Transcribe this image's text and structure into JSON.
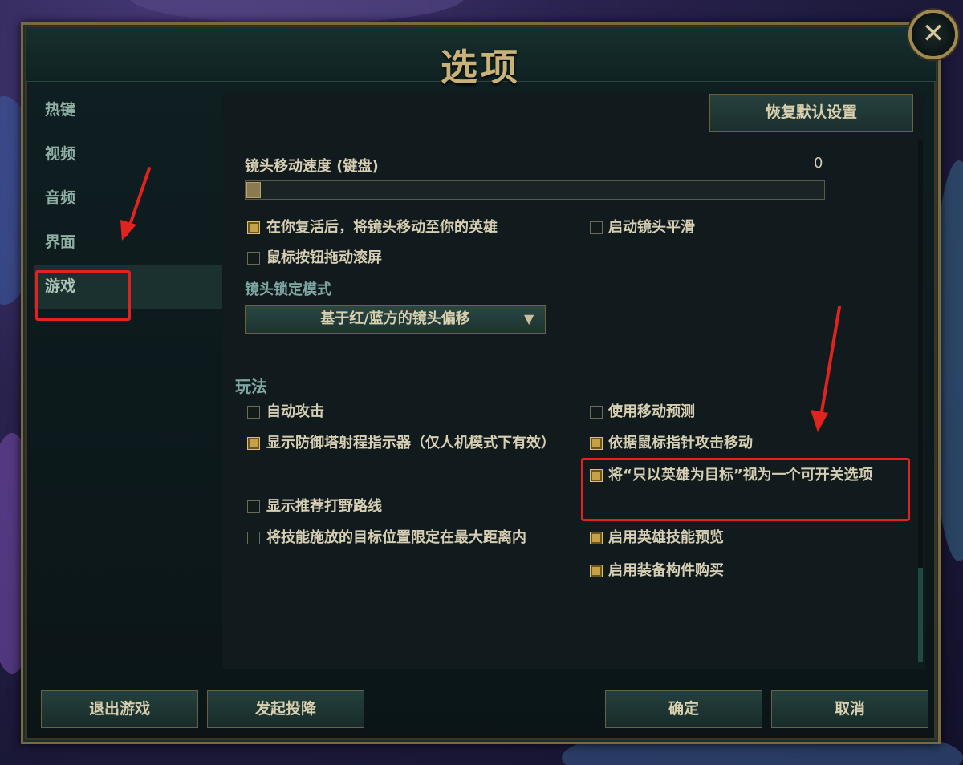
{
  "window": {
    "title": "选项",
    "close_glyph": "✕"
  },
  "sidebar": {
    "items": [
      {
        "label": "热键"
      },
      {
        "label": "视频"
      },
      {
        "label": "音频"
      },
      {
        "label": "界面"
      },
      {
        "label": "游戏",
        "active": true
      }
    ]
  },
  "toolbar": {
    "restore_defaults_label": "恢复默认设置"
  },
  "camera": {
    "speed_label": "镜头移动速度 (键盘)",
    "speed_value": "0",
    "speed_fraction": 0,
    "options": [
      {
        "label": "在你复活后，将镜头移动至你的英雄",
        "checked": true
      },
      {
        "label": "启动镜头平滑",
        "checked": false
      },
      {
        "label": "鼠标按钮拖动滚屏",
        "checked": false
      }
    ],
    "lock_mode_label": "镜头锁定模式",
    "lock_mode_value": "基于红/蓝方的镜头偏移"
  },
  "gameplay": {
    "section_title": "玩法",
    "left_options": [
      {
        "label": "自动攻击",
        "checked": false
      },
      {
        "label": "显示防御塔射程指示器（仅人机模式下有效）",
        "checked": true
      },
      {
        "label": "显示推荐打野路线",
        "checked": false
      },
      {
        "label": "将技能施放的目标位置限定在最大距离内",
        "checked": false
      }
    ],
    "right_options": [
      {
        "label": "使用移动预测",
        "checked": false
      },
      {
        "label": "依据鼠标指针攻击移动",
        "checked": true
      },
      {
        "label": "将“只以英雄为目标”视为一个可开关选项",
        "checked": true
      },
      {
        "label": "启用英雄技能预览",
        "checked": true
      },
      {
        "label": "启用装备构件购买",
        "checked": true
      }
    ]
  },
  "footer": {
    "exit_label": "退出游戏",
    "surrender_label": "发起投降",
    "ok_label": "确定",
    "cancel_label": "取消"
  },
  "annotations": {
    "highlight_color": "#e0231f"
  }
}
